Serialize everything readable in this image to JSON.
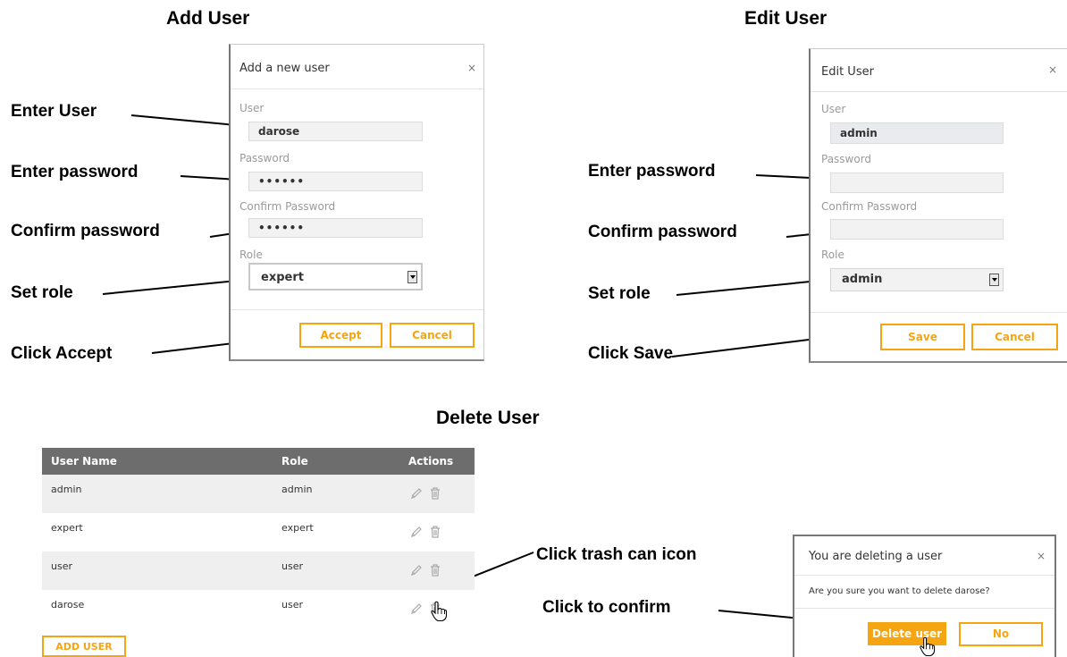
{
  "sections": {
    "add_title": "Add User",
    "edit_title": "Edit User",
    "delete_title": "Delete User"
  },
  "add_dialog": {
    "title": "Add a new user",
    "close": "×",
    "user_label": "User",
    "user_value": "darose",
    "password_label": "Password",
    "password_value": "••••••",
    "confirm_label": "Confirm Password",
    "confirm_value": "••••••",
    "role_label": "Role",
    "role_value": "expert",
    "accept": "Accept",
    "cancel": "Cancel"
  },
  "edit_dialog": {
    "title": "Edit User",
    "close": "×",
    "user_label": "User",
    "user_value": "admin",
    "password_label": "Password",
    "password_value": "",
    "confirm_label": "Confirm Password",
    "confirm_value": "",
    "role_label": "Role",
    "role_value": "admin",
    "save": "Save",
    "cancel": "Cancel"
  },
  "annotations": {
    "add": [
      "Enter User",
      "Enter password",
      "Confirm password",
      "Set role",
      "Click Accept"
    ],
    "edit": [
      "Enter password",
      "Confirm password",
      "Set role",
      "Click Save"
    ],
    "delete": [
      "Click trash can icon",
      "Click to confirm"
    ]
  },
  "user_table": {
    "columns": [
      "User Name",
      "Role",
      "Actions"
    ],
    "rows": [
      {
        "name": "admin",
        "role": "admin"
      },
      {
        "name": "expert",
        "role": "expert"
      },
      {
        "name": "user",
        "role": "user"
      },
      {
        "name": "darose",
        "role": "user"
      }
    ],
    "add_button": "ADD USER"
  },
  "confirm_dialog": {
    "title": "You are deleting a user",
    "close": "×",
    "message": "Are you sure you want to delete darose?",
    "delete": "Delete user",
    "no": "No"
  },
  "colors": {
    "accent": "#f5a511",
    "table_header": "#6d6d6d"
  },
  "icons": [
    "pencil-icon",
    "trash-icon",
    "hand-cursor-icon",
    "dropdown-arrow-icon"
  ]
}
